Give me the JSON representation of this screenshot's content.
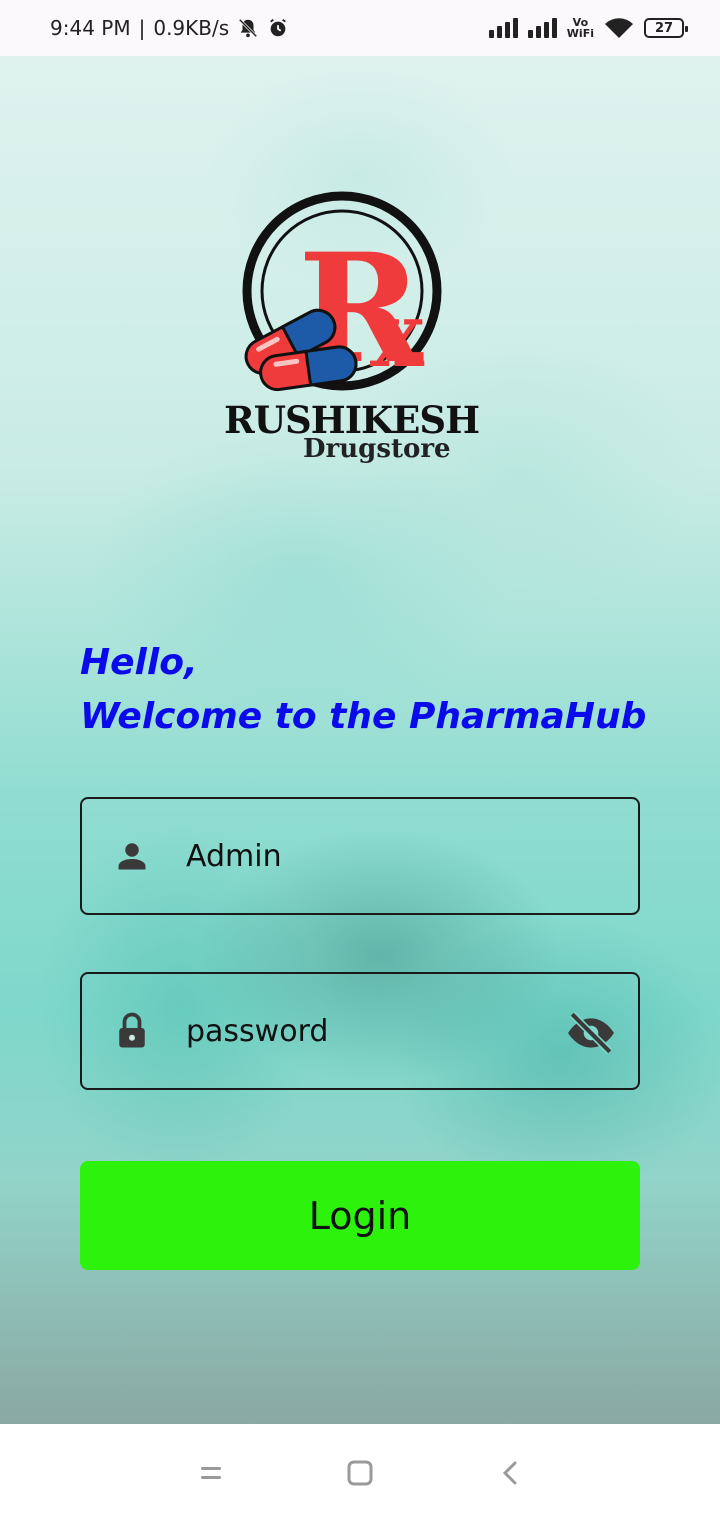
{
  "status_bar": {
    "time": "9:44 PM",
    "separator": "|",
    "net_speed": "0.9KB/s",
    "battery_level": "27",
    "icons": [
      "mute-bell-icon",
      "alarm-icon",
      "signal-icon",
      "signal-icon",
      "vowifi-icon",
      "wifi-icon",
      "battery-icon"
    ],
    "vowifi_top": "Vo",
    "vowifi_bottom": "WiFi"
  },
  "logo": {
    "monogram": "Rx",
    "brand_name": "RUSHIKESH",
    "brand_sub": "Drugstore",
    "colors": {
      "red": "#ef3b3b",
      "blue": "#1d5aa8",
      "ring": "#111111"
    }
  },
  "greeting": {
    "line1": "Hello,",
    "line2": "Welcome to the PharmaHub",
    "color": "#0a0aeb"
  },
  "form": {
    "username": {
      "value": "Admin",
      "placeholder": "",
      "icon": "person-icon"
    },
    "password": {
      "value": "",
      "placeholder": "password",
      "icon": "lock-icon",
      "toggle_icon": "eye-off-icon"
    },
    "login_label": "Login",
    "login_color": "#2df20b"
  },
  "nav_bar": {
    "items": [
      "menu-icon",
      "home-square-icon",
      "back-chevron-icon"
    ]
  }
}
